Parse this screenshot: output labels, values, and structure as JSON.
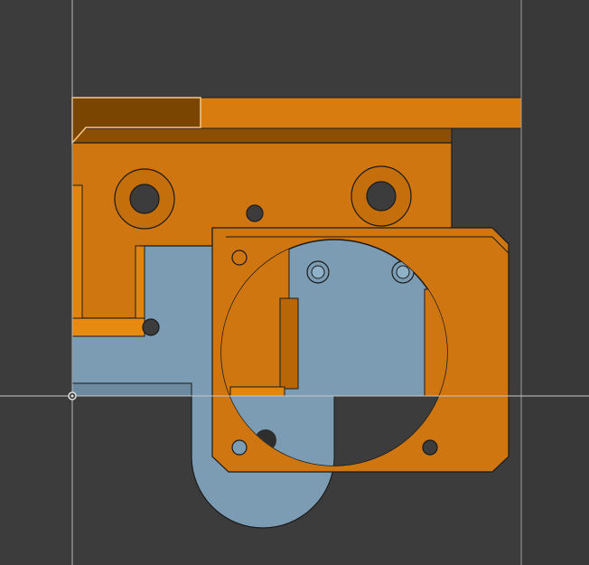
{
  "viewport": {
    "background": "#3c3c3c",
    "part_color": "#d47a10",
    "selected_face_color": "#7a4500",
    "back_body_color": "#7b9cb2",
    "grid_line_color": "#b8b8b8"
  }
}
